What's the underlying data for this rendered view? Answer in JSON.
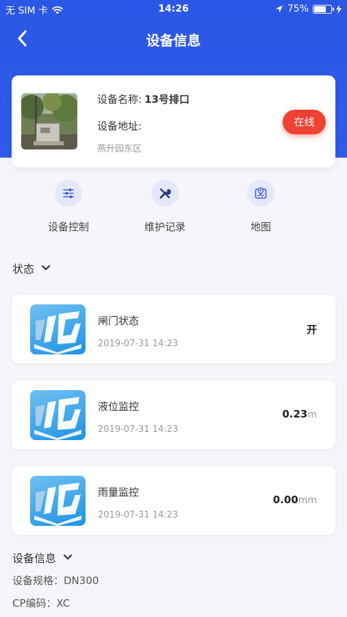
{
  "status_bar": {
    "carrier": "无 SIM 卡",
    "time": "14:26",
    "battery_percent": "75%",
    "battery_level": 0.75
  },
  "nav": {
    "title": "设备信息"
  },
  "device": {
    "name_label": "设备名称:",
    "name_value": "13号排口",
    "address_label": "设备地址:",
    "address_value": "燕升园东区",
    "status_badge": "在线"
  },
  "actions": [
    {
      "label": "设备控制",
      "icon": "sliders-icon"
    },
    {
      "label": "维护记录",
      "icon": "wrench-icon"
    },
    {
      "label": "地图",
      "icon": "map-icon"
    }
  ],
  "status_section": {
    "title": "状态"
  },
  "items": [
    {
      "name": "闸门状态",
      "time": "2019-07-31 14:23",
      "value": "开",
      "unit": ""
    },
    {
      "name": "液位监控",
      "time": "2019-07-31 14:23",
      "value": "0.23",
      "unit": "m"
    },
    {
      "name": "雨量监控",
      "time": "2019-07-31 14:23",
      "value": "0.00",
      "unit": "mm"
    }
  ],
  "info_section": {
    "title": "设备信息",
    "specs": [
      "设备规格：DN300",
      "CP编码：XC"
    ]
  },
  "colors": {
    "primary": "#2f5be8",
    "online": "#ee4233"
  }
}
